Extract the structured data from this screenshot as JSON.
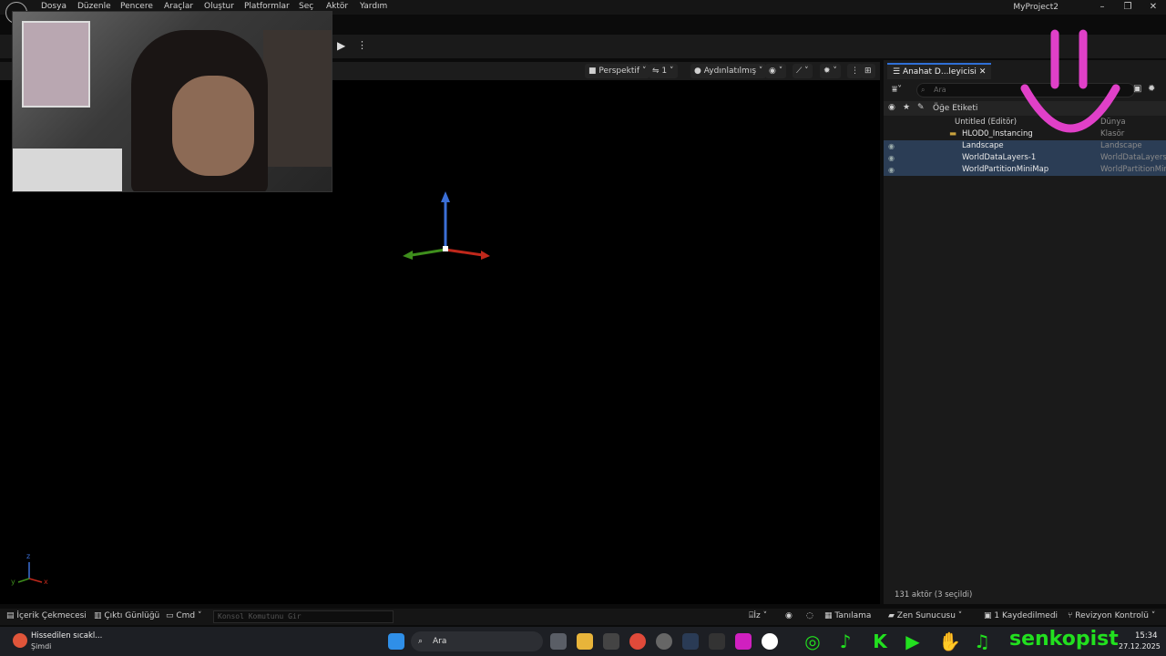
{
  "menu": {
    "items": [
      "Dosya",
      "Düzenle",
      "Pencere",
      "Araçlar",
      "Oluştur",
      "Platformlar",
      "Seç",
      "Aktör",
      "Yardım"
    ],
    "project": "MyProject2"
  },
  "viewport": {
    "perspective": "Perspektif",
    "camera_speed": "1",
    "lighting": "Aydınlatılmış",
    "axes": {
      "x": "x",
      "y": "y",
      "z": "z"
    }
  },
  "outliner": {
    "tab": "Anahat D...leyicisi",
    "search_placeholder": "Ara",
    "header": "Öğe Etiketi",
    "rows": [
      {
        "name": "Untitled (Editör)",
        "type": "Dünya"
      },
      {
        "name": "HLOD0_Instancing",
        "type": "Klasör"
      },
      {
        "name": "Landscape",
        "type": "Landscape"
      },
      {
        "name": "WorldDataLayers-1",
        "type": "WorldDataLayers"
      },
      {
        "name": "WorldPartitionMiniMap",
        "type": "WorldPartitionMini"
      }
    ],
    "status": "131 aktör (3 seçildi)"
  },
  "statusbar": {
    "content_drawer": "İçerik Çekmecesi",
    "output_log": "Çıktı Günlüğü",
    "cmd": "Cmd",
    "console_placeholder": "Konsol Komutunu Gir",
    "iz": "İz",
    "diagnostics": "Tanılama",
    "zen": "Zen Sunucusu",
    "saved": "1 Kaydedilmedi",
    "revision": "Revizyon Kontrolü"
  },
  "taskbar": {
    "weather": "Hissedilen sıcakl...",
    "weather_sub": "Şimdi",
    "search": "Ara",
    "time": "15:34",
    "date": "27.12.2025"
  },
  "overlay": {
    "brand": "senkopist",
    "accent_green": "#22e01f",
    "smiley_color": "#e040c8"
  }
}
